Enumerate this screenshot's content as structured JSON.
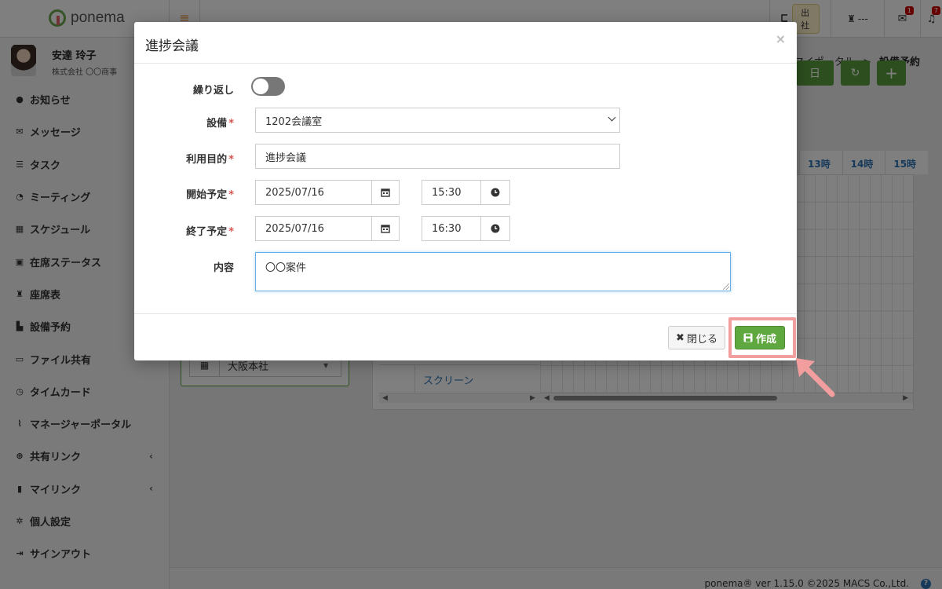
{
  "app": {
    "brand": "ponema"
  },
  "topbar": {
    "burger_glyph": "≡",
    "attendance_status": "出社",
    "seat_status": "---",
    "mail_badge": "1",
    "bell_badge": "7"
  },
  "user": {
    "name": "安達 玲子",
    "company": "株式会社 〇〇商事"
  },
  "sidebar": {
    "items": [
      {
        "label": "お知らせ",
        "icon": "info-icon",
        "glyph": "●"
      },
      {
        "label": "メッセージ",
        "icon": "envelope-icon",
        "glyph": "✉"
      },
      {
        "label": "タスク",
        "icon": "list-icon",
        "glyph": "☰"
      },
      {
        "label": "ミーティング",
        "icon": "chat-icon",
        "glyph": "◔"
      },
      {
        "label": "スケジュール",
        "icon": "calendar-icon",
        "glyph": "▦"
      },
      {
        "label": "在席ステータス",
        "icon": "status-icon",
        "glyph": "▣"
      },
      {
        "label": "座席表",
        "icon": "seat-icon",
        "glyph": "♜"
      },
      {
        "label": "設備予約",
        "icon": "equipment-icon",
        "glyph": "▙"
      },
      {
        "label": "ファイル共有",
        "icon": "folder-icon",
        "glyph": "▭"
      },
      {
        "label": "タイムカード",
        "icon": "clock-icon",
        "glyph": "◷"
      },
      {
        "label": "マネージャーポータル",
        "icon": "chart-icon",
        "glyph": "⌇"
      },
      {
        "label": "共有リンク",
        "icon": "globe-icon",
        "glyph": "⊕",
        "caret": "‹"
      },
      {
        "label": "マイリンク",
        "icon": "bookmark-icon",
        "glyph": "▮",
        "caret": "‹"
      },
      {
        "label": "個人設定",
        "icon": "gear-icon",
        "glyph": "✲"
      },
      {
        "label": "サインアウト",
        "icon": "signout-icon",
        "glyph": "⇥"
      }
    ]
  },
  "breadcrumb": {
    "parent": "マイポータル",
    "separator": ">",
    "current": "設備予約"
  },
  "toolbar": {
    "day_label": "日",
    "refresh_glyph": "↻",
    "add_glyph": "+"
  },
  "timeline": {
    "hours": [
      "13時",
      "14時",
      "15時"
    ],
    "resource_row": "スクリーン",
    "branch": "大阪本社"
  },
  "footer": {
    "text": "ponema® ver 1.15.0 ©2025 MACS Co.,Ltd.",
    "help": "?"
  },
  "modal": {
    "title": "進捗会議",
    "close_glyph": "×",
    "repeat_label": "繰り返し",
    "facility_label": "設備",
    "facility_value": "1202会議室",
    "purpose_label": "利用目的",
    "purpose_value": "進捗会議",
    "start_label": "開始予定",
    "start_date": "2025/07/16",
    "start_time": "15:30",
    "end_label": "終了予定",
    "end_date": "2025/07/16",
    "end_time": "16:30",
    "content_label": "内容",
    "content_value": "〇〇案件",
    "required_mark": "*",
    "close_button": "閉じる",
    "create_button": "作成"
  },
  "colors": {
    "accent_green": "#5ea83f",
    "required_red": "#d9534f",
    "highlight_pink": "#f29e9e",
    "link_blue": "#2e75b6"
  }
}
